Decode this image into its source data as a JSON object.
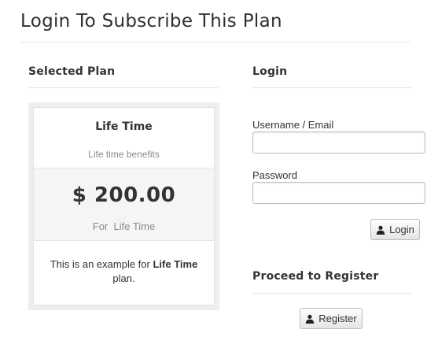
{
  "page": {
    "title": "Login To Subscribe This Plan"
  },
  "selected_plan": {
    "heading": "Selected Plan",
    "name": "Life Time",
    "benefits": "Life time benefits",
    "price": "$ 200.00",
    "period": "For  Life Time",
    "description_prefix": "This is an example for ",
    "description_bold": "Life Time",
    "description_suffix": "plan."
  },
  "login": {
    "heading": "Login",
    "username_label": "Username / Email",
    "username_value": "",
    "password_label": "Password",
    "password_value": "",
    "button_label": "Login",
    "button_icon": "user-icon"
  },
  "register": {
    "heading": "Proceed to Register",
    "button_label": "Register",
    "button_icon": "user-icon"
  }
}
